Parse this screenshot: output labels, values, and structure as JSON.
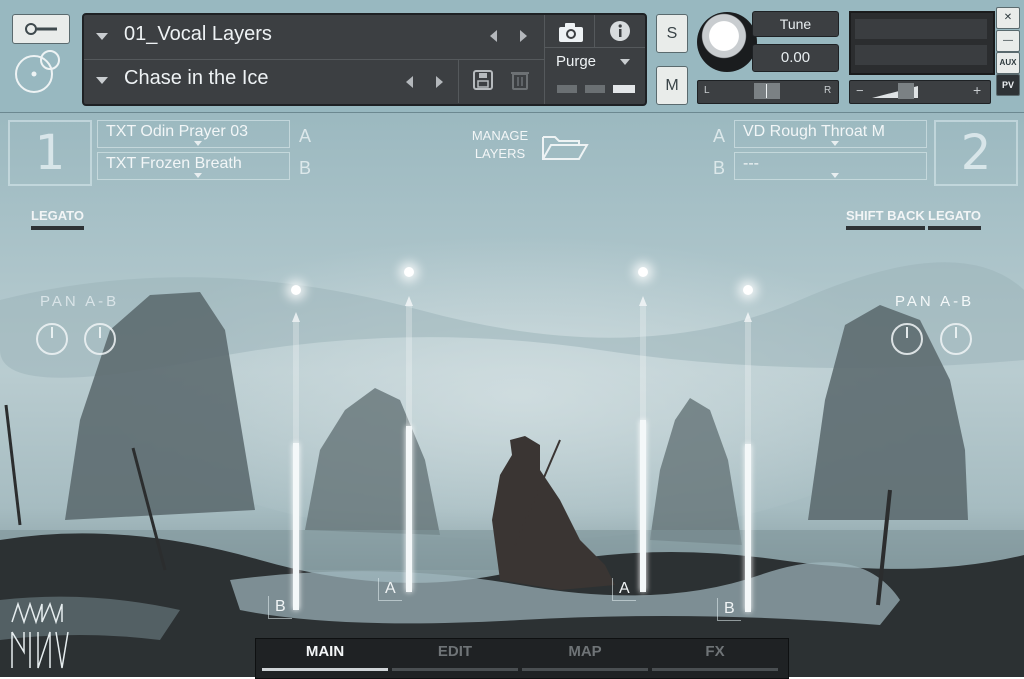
{
  "colors": {
    "panel": "#3c3f42",
    "header_bg": "#98b8c0",
    "button_light": "#e9ecea",
    "text_light": "#eef2f4"
  },
  "header": {
    "instrument": {
      "name": "01_Vocal Layers",
      "snapshot": "Chase in the Ice"
    },
    "purge": {
      "label": "Purge"
    },
    "solo_label": "S",
    "mute_label": "M",
    "tune": {
      "label": "Tune",
      "value": "0.00"
    },
    "pan_slider": {
      "left": "L",
      "right": "R"
    },
    "volume_slider": {
      "minus": "−",
      "plus": "+"
    },
    "window_buttons": {
      "close": "✕",
      "minimize": "—",
      "aux": "AUX",
      "pv": "PV"
    }
  },
  "layers": {
    "manage_label_1": "MANAGE",
    "manage_label_2": "LAYERS",
    "left": {
      "number": "1",
      "slot_a": "TXT Odin Prayer 03",
      "slot_b": "TXT Frozen Breath",
      "letter_a": "A",
      "letter_b": "B",
      "legato": "LEGATO",
      "pan_label": "PAN A-B"
    },
    "right": {
      "number": "2",
      "slot_a": "VD Rough Throat M",
      "slot_b": "---",
      "letter_a": "A",
      "letter_b": "B",
      "shift_back": "SHIFT BACK",
      "legato": "LEGATO",
      "pan_label": "PAN A-B"
    }
  },
  "faders": [
    {
      "letter": "B",
      "level": 0.58
    },
    {
      "letter": "A",
      "level": 0.58
    },
    {
      "letter": "A",
      "level": 0.6
    },
    {
      "letter": "B",
      "level": 0.58
    }
  ],
  "tabs": [
    {
      "label": "MAIN",
      "active": true
    },
    {
      "label": "EDIT",
      "active": false
    },
    {
      "label": "MAP",
      "active": false
    },
    {
      "label": "FX",
      "active": false
    }
  ]
}
